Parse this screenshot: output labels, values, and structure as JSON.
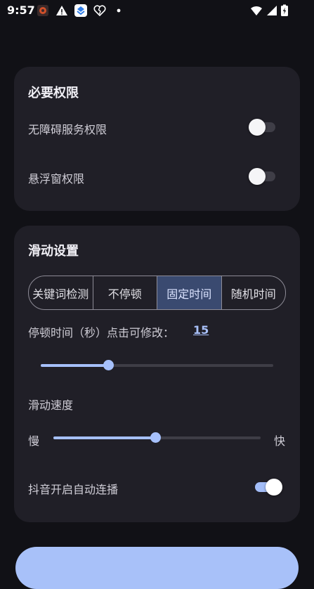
{
  "status_bar": {
    "time": "9:57",
    "notif_icons": [
      "app-icon",
      "warning-icon",
      "app-blue-icon",
      "heart-broken-icon",
      "dot-icon"
    ],
    "system_icons": [
      "wifi-icon",
      "signal-icon",
      "battery-icon"
    ]
  },
  "permissions": {
    "title": "必要权限",
    "accessibility_label": "无障碍服务权限",
    "accessibility_enabled": false,
    "overlay_label": "悬浮窗权限",
    "overlay_enabled": false
  },
  "swipe": {
    "title": "滑动设置",
    "modes": [
      "关键词检测",
      "不停顿",
      "固定时间",
      "随机时间"
    ],
    "selected_mode_index": 2,
    "pause_label": "停顿时间（秒）点击可修改：",
    "pause_value": "15",
    "pause_slider_fraction": 0.29,
    "speed_label": "滑动速度",
    "speed_slow": "慢",
    "speed_fast": "快",
    "speed_slider_fraction": 0.49,
    "autoplay_label": "抖音开启自动连播",
    "autoplay_enabled": true
  },
  "colors": {
    "accent": "#a6c0fb",
    "card": "#201f27",
    "background": "#111116",
    "segment_active": "#3a4a70"
  }
}
